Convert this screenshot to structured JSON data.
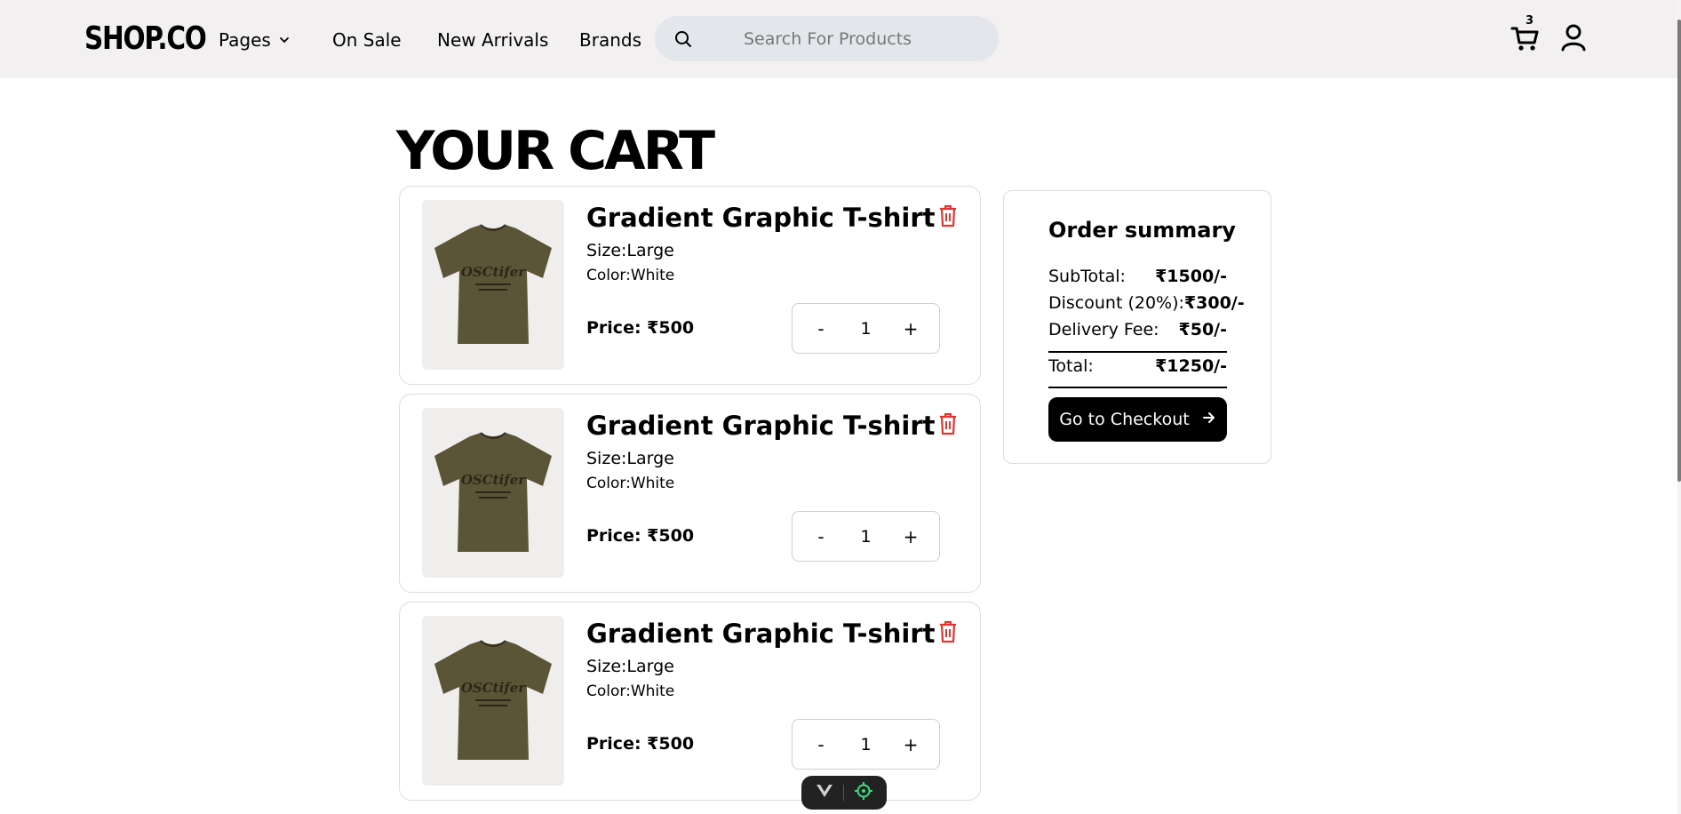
{
  "header": {
    "logo": "SHOP.CO",
    "nav": {
      "pages": "Pages",
      "on_sale": "On Sale",
      "new_arrivals": "New Arrivals",
      "brands": "Brands"
    },
    "search_placeholder": "Search For Products",
    "cart_count": "3"
  },
  "page_title": "YOUR CART",
  "cart_items": [
    {
      "name": "Gradient Graphic T-shirt",
      "size": "Size:Large",
      "color": "Color:White",
      "price": "Price: ₹500",
      "qty_minus": "-",
      "qty": "1",
      "qty_plus": "+"
    },
    {
      "name": "Gradient Graphic T-shirt",
      "size": "Size:Large",
      "color": "Color:White",
      "price": "Price: ₹500",
      "qty_minus": "-",
      "qty": "1",
      "qty_plus": "+"
    },
    {
      "name": "Gradient Graphic T-shirt",
      "size": "Size:Large",
      "color": "Color:White",
      "price": "Price: ₹500",
      "qty_minus": "-",
      "qty": "1",
      "qty_plus": "+"
    }
  ],
  "summary": {
    "title": "Order summary",
    "subtotal_label": "SubTotal:",
    "subtotal_value": "₹1500/-",
    "discount_label": "Discount (20%):",
    "discount_value": "₹300/-",
    "delivery_label": "Delivery Fee:",
    "delivery_value": "₹50/-",
    "total_label": "Total:",
    "total_value": "₹1250/-",
    "checkout_label": "Go to Checkout"
  },
  "icons": {
    "delete": "trash-icon",
    "cart": "cart-icon",
    "user": "user-icon",
    "search": "search-icon"
  },
  "colors": {
    "header_bg": "#f2f0f1",
    "search_bg": "#e3e6ea",
    "delete_red": "#e3342f",
    "tshirt": "#5b5537"
  }
}
